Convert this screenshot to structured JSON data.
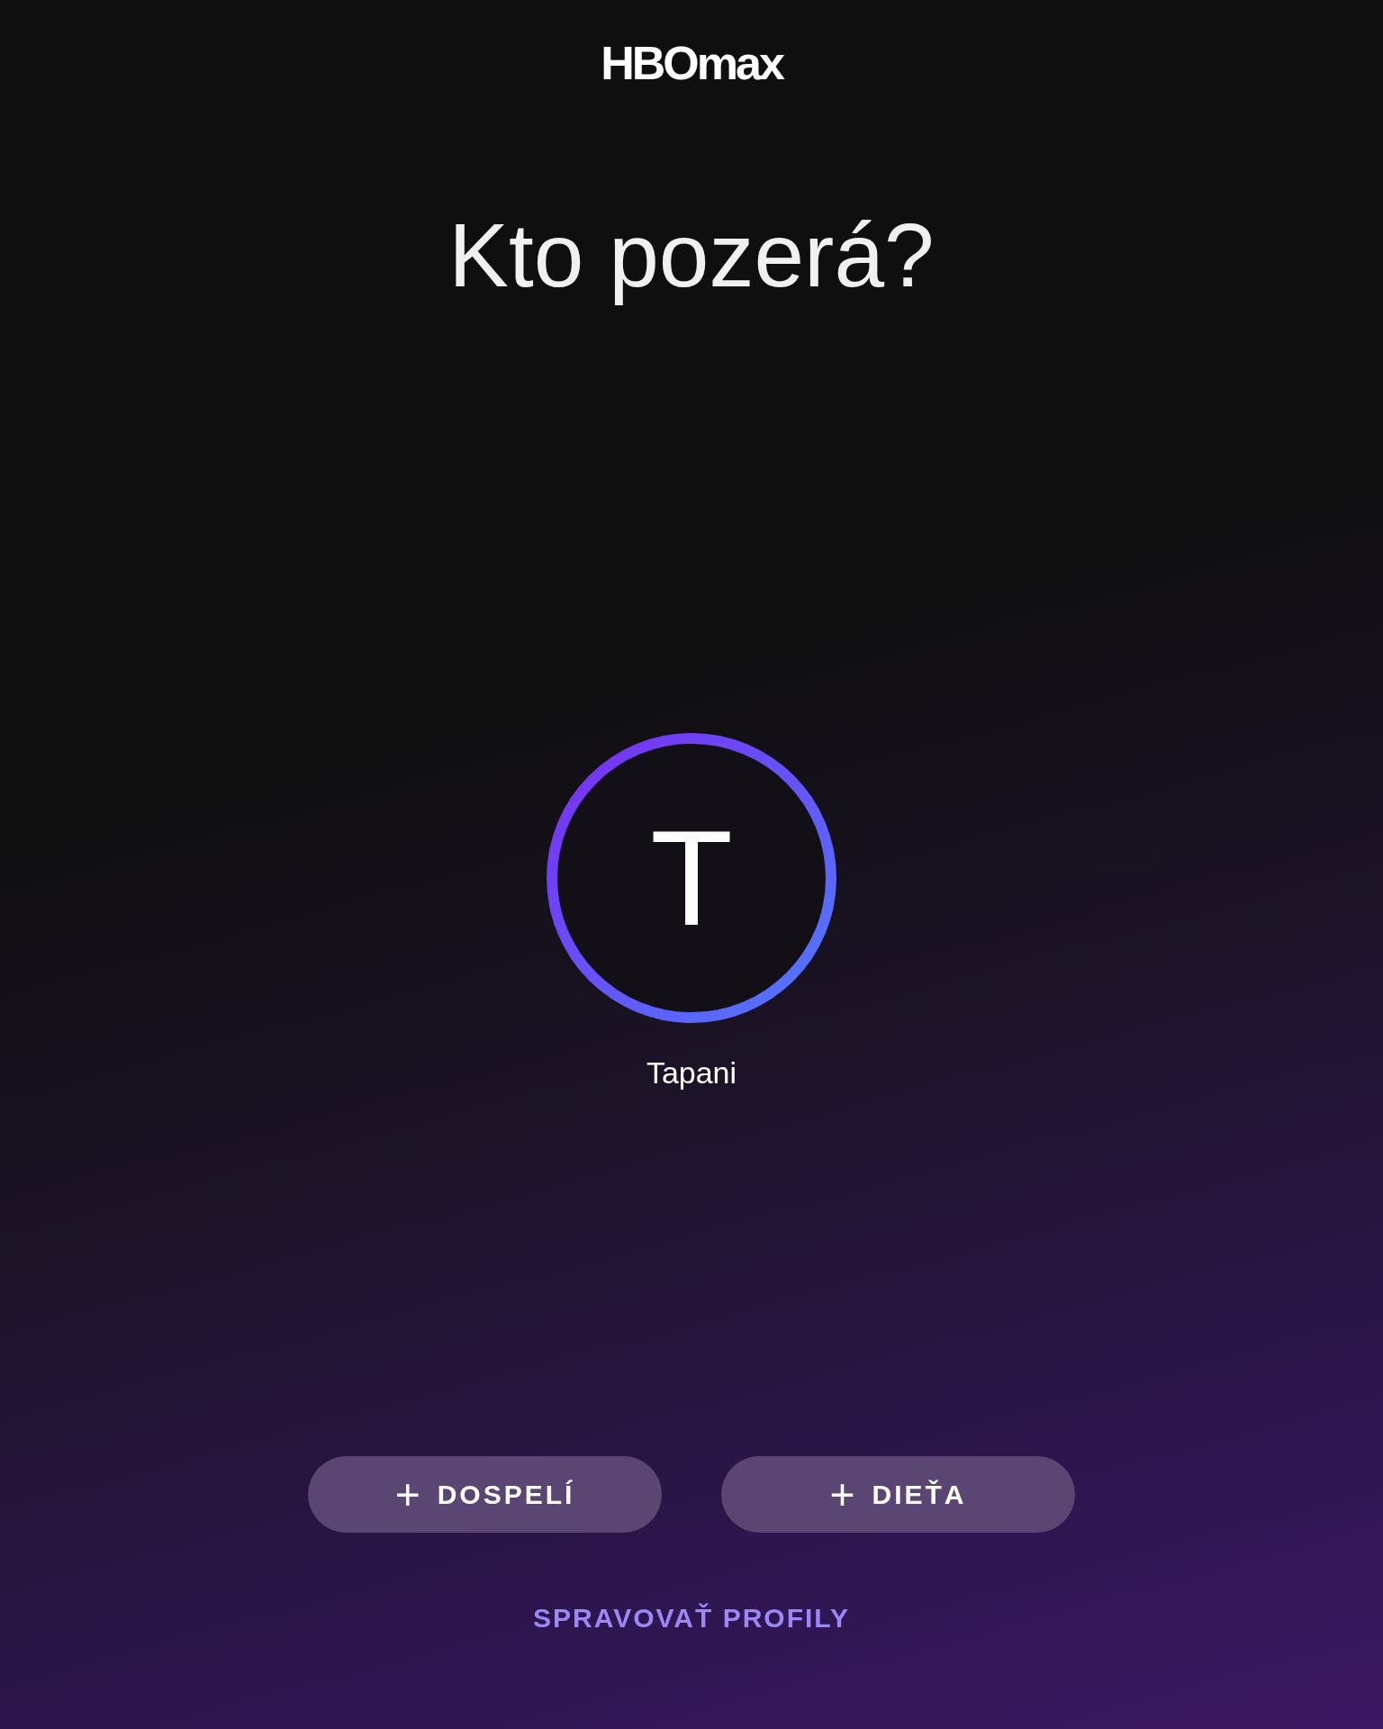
{
  "logo": "HBOmax",
  "title": "Kto pozerá?",
  "profiles": [
    {
      "initial": "T",
      "name": "Tapani"
    }
  ],
  "add_buttons": [
    {
      "icon": "+",
      "label": "DOSPELÍ"
    },
    {
      "icon": "+",
      "label": "DIEŤA"
    }
  ],
  "manage_link": "SPRAVOVAŤ PROFILY"
}
